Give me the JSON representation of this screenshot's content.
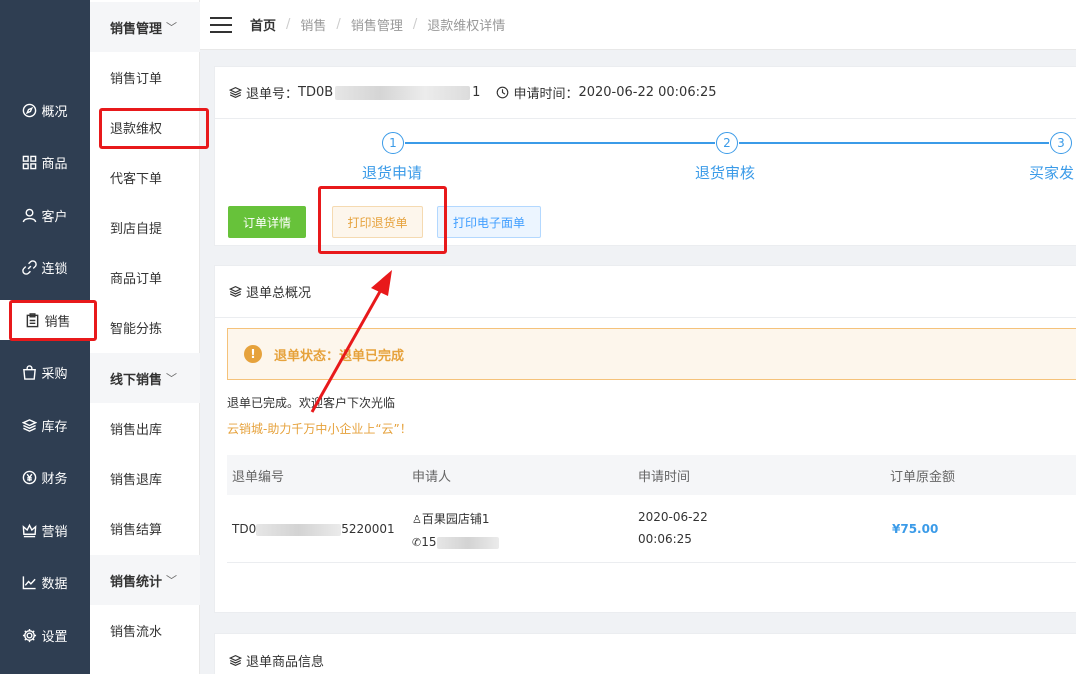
{
  "nav": [
    {
      "icon": "compass-icon",
      "label": "概况"
    },
    {
      "icon": "grid-icon",
      "label": "商品"
    },
    {
      "icon": "user-icon",
      "label": "客户"
    },
    {
      "icon": "link-icon",
      "label": "连锁"
    },
    {
      "icon": "clipboard-icon",
      "label": "销售"
    },
    {
      "icon": "bag-icon",
      "label": "采购"
    },
    {
      "icon": "layers-icon",
      "label": "库存"
    },
    {
      "icon": "yen-icon",
      "label": "财务"
    },
    {
      "icon": "crown-icon",
      "label": "营销"
    },
    {
      "icon": "chart-icon",
      "label": "数据"
    },
    {
      "icon": "gear-icon",
      "label": "设置"
    }
  ],
  "submenu": {
    "group1": "销售管理",
    "items1": [
      "销售订单",
      "退款维权",
      "代客下单",
      "到店自提",
      "商品订单",
      "智能分拣"
    ],
    "group2": "线下销售",
    "items2": [
      "销售出库",
      "销售退库",
      "销售结算"
    ],
    "group3": "销售统计",
    "items3": [
      "销售流水"
    ]
  },
  "breadcrumb": [
    "首页",
    "销售",
    "销售管理",
    "退款维权详情"
  ],
  "refund": {
    "no_label": "退单号：",
    "no_prefix": "TD0B",
    "no_suffix": "1",
    "apply_time_label": "申请时间：",
    "apply_time": "2020-06-22 00:06:25"
  },
  "steps": [
    {
      "num": "1",
      "label": "退货申请"
    },
    {
      "num": "2",
      "label": "退货审核"
    },
    {
      "num": "3",
      "label": "买家发"
    }
  ],
  "buttons": {
    "order_detail": "订单详情",
    "print_return": "打印退货单",
    "print_waybill": "打印电子面单"
  },
  "overview": {
    "title": "退单总概况",
    "status": "退单状态：退单已完成",
    "message": "退单已完成。欢迎客户下次光临",
    "slogan": "云销城-助力千万中小企业上“云”！",
    "columns": [
      "退单编号",
      "申请人",
      "申请时间",
      "订单原金额"
    ],
    "row": {
      "no_prefix": "TD0",
      "no_suffix": "5220001",
      "applicant": "百果园店铺1",
      "phone_prefix": "15",
      "date": "2020-06-22",
      "time": "00:06:25",
      "amount": "¥75.00"
    }
  },
  "goods": {
    "title": "退单商品信息"
  },
  "colors": {
    "nav_bg": "#2f3e52",
    "accent": "#3b9be8",
    "annotation": "#e8191b"
  }
}
